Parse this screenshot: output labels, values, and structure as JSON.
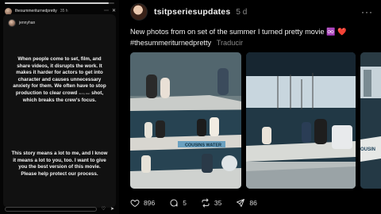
{
  "story": {
    "progress_fraction": 0.95,
    "header_user": "thesummeriturnedpretty",
    "header_time": "35 h",
    "card_user": "jennyhan",
    "text_part1": "When people come to set, film, and share videos, it disrupts the work. It makes it harder for actors to get into character and causes unnecessary anxiety for them. We often have to stop production to clear crowd",
    "tiny_label": "Jenny Han",
    "text_part1_end": "shot, which breaks the crew's focus.",
    "text_part2": "This story means a lot to me, and I know it means a lot to you, too. I want to give you the best version of this movie. Please help protect our process."
  },
  "post": {
    "username": "tsitpseriesupdates",
    "time": "5 d",
    "more_icon": "more-horizontal-icon",
    "text_line1": "New photos from on set of the summer I turned pretty movie",
    "text_emoji": "♾️",
    "text_heart": "❤️",
    "hashtag": "#thesummeriturnedpretty",
    "translate": "Traducir",
    "media_label_1": "COUSINS WATER",
    "media_label_2": "OUSIN"
  },
  "actions": {
    "likes": "896",
    "replies": "5",
    "reposts": "35",
    "shares": "86",
    "icons": [
      "heart-icon",
      "comment-icon",
      "repost-icon",
      "share-icon"
    ]
  },
  "colors": {
    "background": "#000000",
    "text": "#f2f2f2",
    "muted": "#8a8a8a",
    "heart": "#e0245e"
  }
}
